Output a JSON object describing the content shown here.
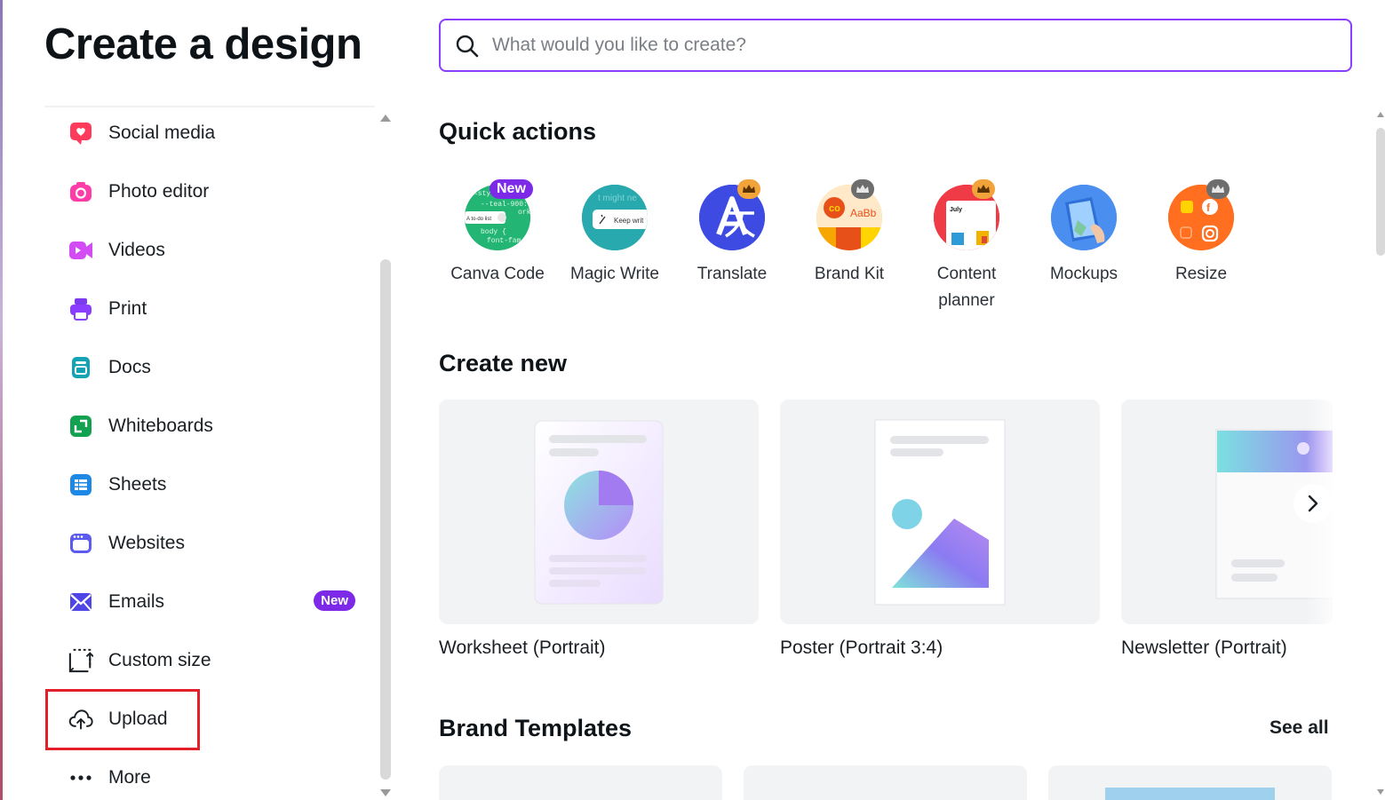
{
  "page": {
    "title": "Create a design"
  },
  "search": {
    "placeholder": "What would you like to create?"
  },
  "sidebar": {
    "items": [
      {
        "label": "Social media",
        "icon": "heart-icon"
      },
      {
        "label": "Photo editor",
        "icon": "camera-icon"
      },
      {
        "label": "Videos",
        "icon": "video-icon"
      },
      {
        "label": "Print",
        "icon": "printer-icon"
      },
      {
        "label": "Docs",
        "icon": "doc-icon"
      },
      {
        "label": "Whiteboards",
        "icon": "whiteboard-icon"
      },
      {
        "label": "Sheets",
        "icon": "sheets-icon"
      },
      {
        "label": "Websites",
        "icon": "browser-icon"
      },
      {
        "label": "Emails",
        "icon": "envelope-icon",
        "badge": "New"
      },
      {
        "label": "Custom size",
        "icon": "custom-size-icon"
      },
      {
        "label": "Upload",
        "icon": "cloud-upload-icon",
        "highlighted": true
      },
      {
        "label": "More",
        "icon": "more-dots-icon"
      }
    ]
  },
  "quick_actions": {
    "title": "Quick actions",
    "items": [
      {
        "label": "Canva Code",
        "badge": "New",
        "icon": "canva-code-icon"
      },
      {
        "label": "Magic Write",
        "icon": "magic-write-icon"
      },
      {
        "label": "Translate",
        "icon": "translate-icon",
        "premium": true
      },
      {
        "label": "Brand Kit",
        "icon": "brand-kit-icon",
        "premium": true
      },
      {
        "label": "Content planner",
        "icon": "content-planner-icon",
        "premium": true
      },
      {
        "label": "Mockups",
        "icon": "mockups-icon"
      },
      {
        "label": "Resize",
        "icon": "resize-icon",
        "premium": true
      }
    ],
    "thumb_text": {
      "code_lines": [
        "<sty",
        "--teal-900:",
        "ork",
        "body {",
        "font-fam"
      ],
      "code_todo": "A to-do list",
      "magic_write": "Keep writ",
      "magic_write_bg": "t might ne",
      "brand_kit": "AaBb",
      "content_planner": "July"
    }
  },
  "create_new": {
    "title": "Create new",
    "cards": [
      {
        "label": "Worksheet (Portrait)"
      },
      {
        "label": "Poster (Portrait 3:4)"
      },
      {
        "label": "Newsletter (Portrait)"
      }
    ]
  },
  "brand_templates": {
    "title": "Brand Templates",
    "see_all": "See all"
  },
  "colors": {
    "accent": "#8b3dff",
    "badge": "#7d2ae8",
    "highlight_box": "#e3202a"
  }
}
